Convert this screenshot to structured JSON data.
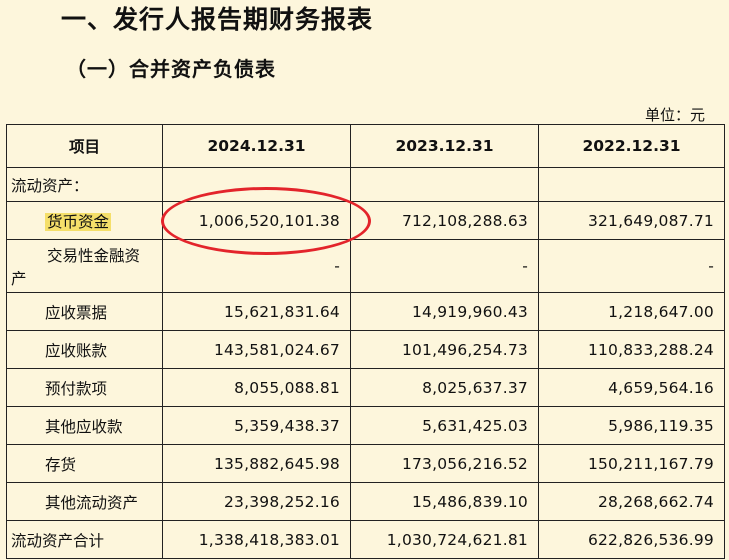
{
  "title": "一、发行人报告期财务报表",
  "subtitle": "（一）合并资产负债表",
  "unit": "单位：元",
  "columns": [
    "项目",
    "2024.12.31",
    "2023.12.31",
    "2022.12.31"
  ],
  "section_label": "流动资产：",
  "rows": [
    {
      "name": "货币资金",
      "v1": "1,006,520,101.38",
      "v2": "712,108,288.63",
      "v3": "321,649,087.71"
    },
    {
      "name_line1": "交易性金融资",
      "name_line2": "产",
      "v1": "-",
      "v2": "-",
      "v3": "-"
    },
    {
      "name": "应收票据",
      "v1": "15,621,831.64",
      "v2": "14,919,960.43",
      "v3": "1,218,647.00"
    },
    {
      "name": "应收账款",
      "v1": "143,581,024.67",
      "v2": "101,496,254.73",
      "v3": "110,833,288.24"
    },
    {
      "name": "预付款项",
      "v1": "8,055,088.81",
      "v2": "8,025,637.37",
      "v3": "4,659,564.16"
    },
    {
      "name": "其他应收款",
      "v1": "5,359,438.37",
      "v2": "5,631,425.03",
      "v3": "5,986,119.35"
    },
    {
      "name": "存货",
      "v1": "135,882,645.98",
      "v2": "173,056,216.52",
      "v3": "150,211,167.79"
    },
    {
      "name": "其他流动资产",
      "v1": "23,398,252.16",
      "v2": "15,486,839.10",
      "v3": "28,268,662.74"
    },
    {
      "name": "流动资产合计",
      "v1": "1,338,418,383.01",
      "v2": "1,030,724,621.81",
      "v3": "622,826,536.99"
    }
  ],
  "highlight_color": "#f5df6a",
  "annotation_color": "#e3242b"
}
